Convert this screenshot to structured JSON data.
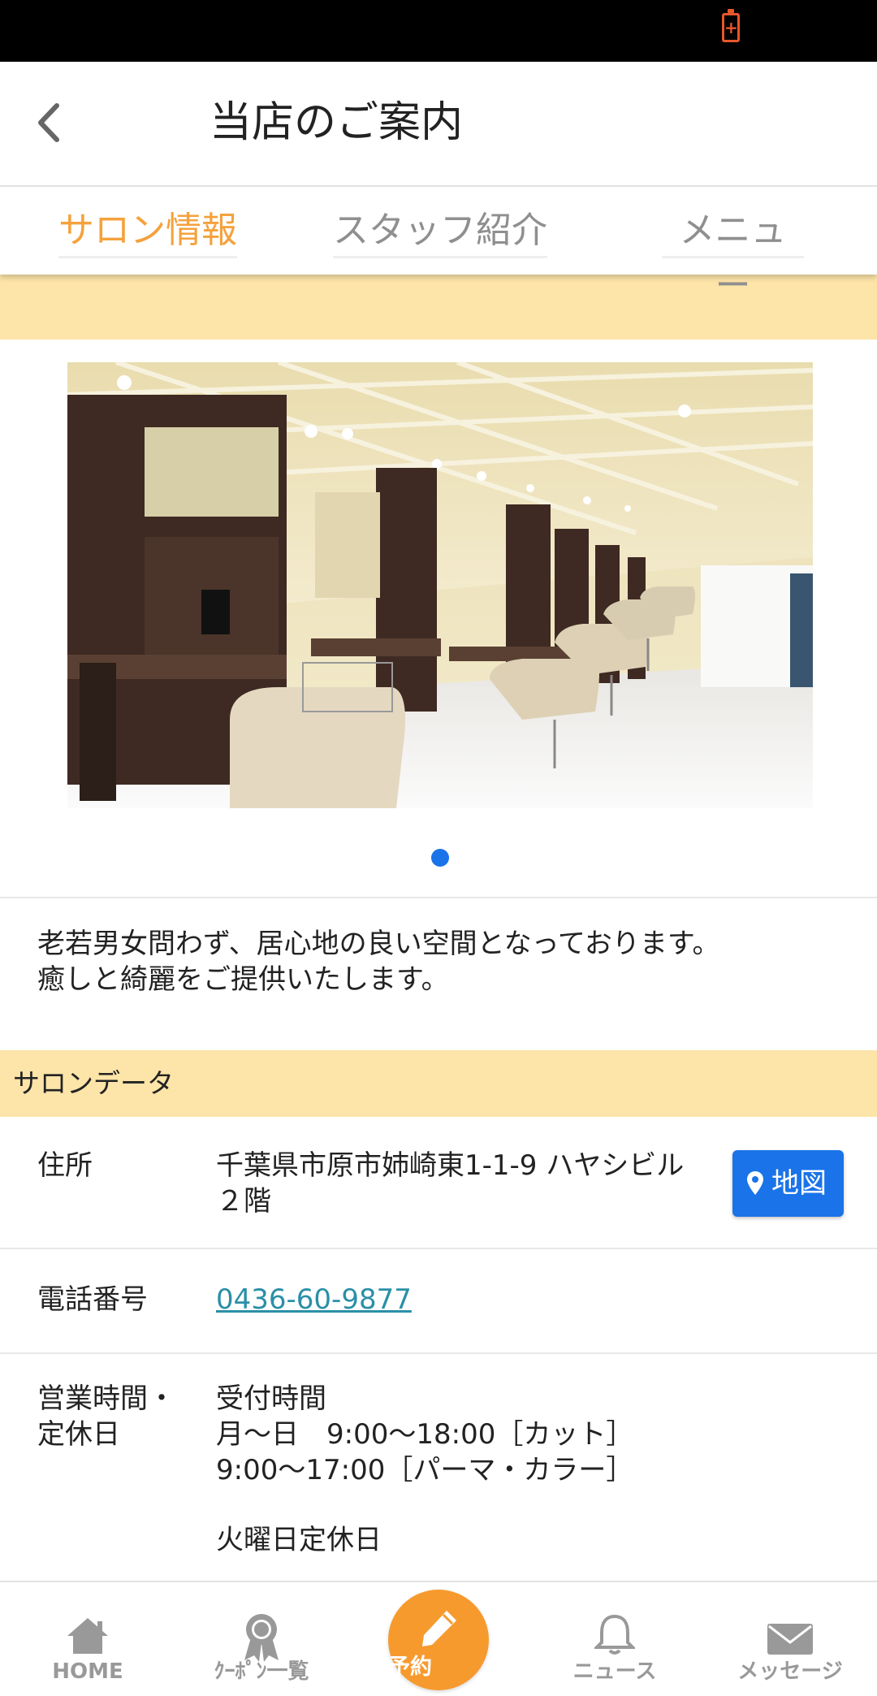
{
  "header": {
    "title": "当店のご案内"
  },
  "tabs": [
    {
      "label": "サロン情報",
      "active": true
    },
    {
      "label": "スタッフ紹介",
      "active": false
    },
    {
      "label": "メニュー",
      "active": false
    }
  ],
  "carousel": {
    "current_slide": 1,
    "total_slides": 1
  },
  "description": {
    "line1": "老若男女問わず、居心地の良い空間となっております。",
    "line2": "癒しと綺麗をご提供いたします。"
  },
  "salon_data": {
    "header": "サロンデータ",
    "address": {
      "label": "住所",
      "line1": "千葉県市原市姉崎東1-1-9 ハヤシビル",
      "line2": "２階",
      "map_button": "地図"
    },
    "phone": {
      "label": "電話番号",
      "value": "0436-60-9877"
    },
    "hours": {
      "label_line1": "営業時間・",
      "label_line2": "定休日",
      "line1": "受付時間",
      "line2": "月～日　9:00～18:00［カット］",
      "line3": "9:00～17:00［パーマ・カラー］",
      "line4": "火曜日定休日"
    }
  },
  "bottom_nav": {
    "home": "HOME",
    "coupons": "ｸｰﾎﾟﾝ一覧",
    "reserve": "予約",
    "news": "ニュース",
    "messages": "メッセージ"
  },
  "colors": {
    "accent_orange": "#f79a2e",
    "tab_active": "#f5a13c",
    "section_bg": "#fde4a8",
    "link_blue": "#1a73e8",
    "phone_link": "#2a8fa8",
    "battery": "#e8562a"
  }
}
